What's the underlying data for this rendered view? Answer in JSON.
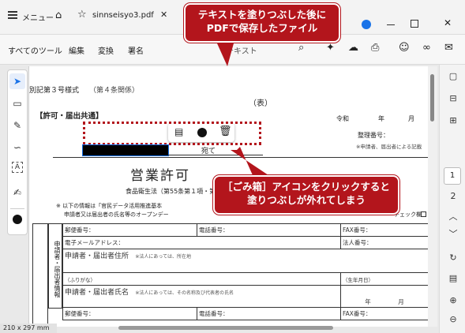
{
  "titlebar": {
    "menu_label": "メニュー",
    "tab_title": "sinnseisyo3.pdf"
  },
  "toolbar": {
    "items": [
      "すべてのツール",
      "編集",
      "変換",
      "署名"
    ],
    "search_text": "テキスト"
  },
  "doc": {
    "form_number": "別記第３号様式",
    "form_ref": "（第４条関係）",
    "omote": "（表）",
    "section_title": "【許可・届出共通】",
    "date_parts": [
      "令和",
      "年",
      "月"
    ],
    "seiri_label": "整理番号：",
    "note_right": "※申請者、届出者による記載",
    "atesaki": "宛て",
    "title_big": "営業許可",
    "law_line": "食品衛生法（第55条第１項・第57条第",
    "info_line1": "※ 以下の情報は「官民データ活用推進基本",
    "info_line2": "申請者又は届出者の氏名等のオープンデー",
    "check_label": "チェック欄",
    "side_label": "申請者・届出者情報",
    "rows": [
      {
        "c1": "郵便番号：",
        "c2": "電話番号：",
        "c3": "FAX番号："
      },
      {
        "c1": "電子メールアドレス：",
        "c3": "法人番号："
      },
      {
        "c1": "申請者・届出者住所",
        "note": "※法人にあっては、所在地"
      },
      {
        "c1": "（ふりがな）",
        "c3": "（生年月日）"
      },
      {
        "c1": "申請者・届出者氏名",
        "note": "※法人にあっては、その名称及び代表者の氏名",
        "c3a": "年",
        "c3b": "月"
      },
      {
        "c1": "郵便番号：",
        "c2": "電話番号：",
        "c3": "FAX番号："
      }
    ]
  },
  "page_size": "210 x 297 mm",
  "pages": [
    "1",
    "2"
  ],
  "callouts": {
    "top": [
      "テキストを塗りつぶした後に",
      "PDFで保存したファイル"
    ],
    "bottom": [
      "［ごみ箱］アイコンをクリックすると",
      "塗りつぶしが外れてしまう"
    ]
  },
  "colors": {
    "callout": "#b3151c",
    "accent": "#1a73e8"
  }
}
